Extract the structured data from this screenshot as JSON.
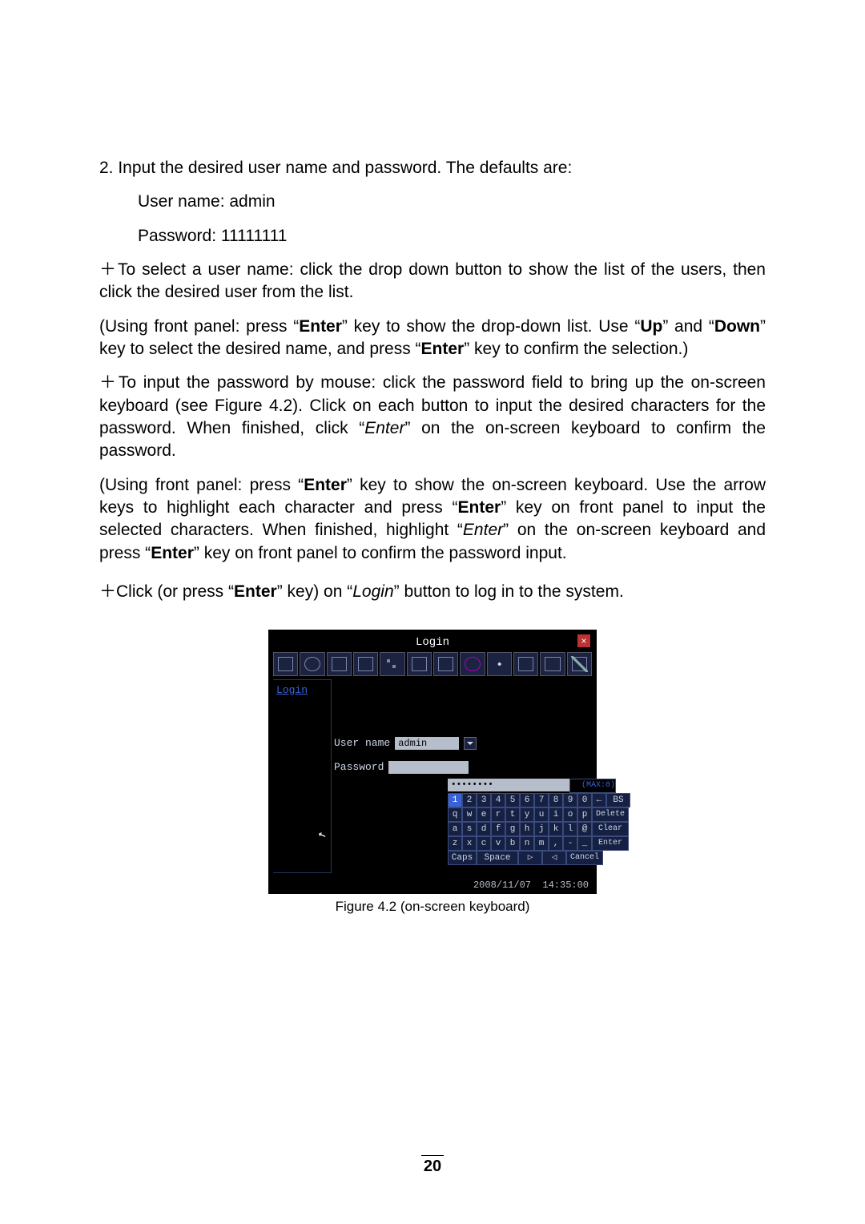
{
  "page_number": "20",
  "body": {
    "step_line": "2. Input the desired user name and password. The defaults are:",
    "defaults_user_line": "User name: admin",
    "defaults_pass_line": "Password: 11111111",
    "para_select_user": "＋To select a user name: click the drop down button to show the list of the users, then click the desired user from the list.",
    "para_select_user_panel_a": "(Using front panel: press “",
    "para_select_user_panel_b": "” key to show the drop-down list. Use “",
    "para_select_user_panel_c": "” and “",
    "para_select_user_panel_d": "” key to select the desired name, and press “",
    "para_select_user_panel_e": "” key to confirm the selection.)",
    "enter_txt": "Enter",
    "up_txt": "Up",
    "down_txt": "Down",
    "para_input_pwd_a": "＋To input the password by mouse: click the password field to bring up the on-screen keyboard (see Figure 4.2). Click on each button to input the desired characters for the password. When finished, click “",
    "para_input_pwd_italic": "Enter",
    "para_input_pwd_b": "” on the on-screen keyboard to confirm the password.",
    "para_input_pwd_panel_a": "(Using front panel: press “",
    "para_input_pwd_panel_b": "” key to show the on-screen keyboard. Use the arrow keys to highlight each character and press “",
    "para_input_pwd_panel_c": "” key on front panel to input the selected characters. When finished, highlight “",
    "para_input_pwd_panel_d": "” on the on-screen keyboard and press “",
    "para_input_pwd_panel_e": "” key on front panel to confirm the password input.",
    "para_login_a": "＋Click (or press “",
    "para_login_b": "” key) on “",
    "para_login_italic": "Login",
    "para_login_c": "” button to log in to the system."
  },
  "figure": {
    "caption": "Figure 4.2 (on-screen keyboard)",
    "window_title": "Login",
    "sidebar_label": "Login",
    "username_label": "User name",
    "username_value": "admin",
    "password_label": "Password",
    "password_value": "••••••••",
    "max_label": "(MAX:8)",
    "timestamp": "2008/11/07  14:35:00",
    "keys": {
      "row1": [
        "1",
        "2",
        "3",
        "4",
        "5",
        "6",
        "7",
        "8",
        "9",
        "0",
        "←",
        "BS"
      ],
      "row2": [
        "q",
        "w",
        "e",
        "r",
        "t",
        "y",
        "u",
        "i",
        "o",
        "p",
        "Delete"
      ],
      "row3": [
        "a",
        "s",
        "d",
        "f",
        "g",
        "h",
        "j",
        "k",
        "l",
        "@",
        "Clear"
      ],
      "row4": [
        "z",
        "x",
        "c",
        "v",
        "b",
        "n",
        "m",
        ",",
        "-",
        "_",
        "Enter"
      ],
      "row5": [
        "Caps",
        "Space",
        "▷",
        "◁",
        "Cancel"
      ]
    }
  }
}
